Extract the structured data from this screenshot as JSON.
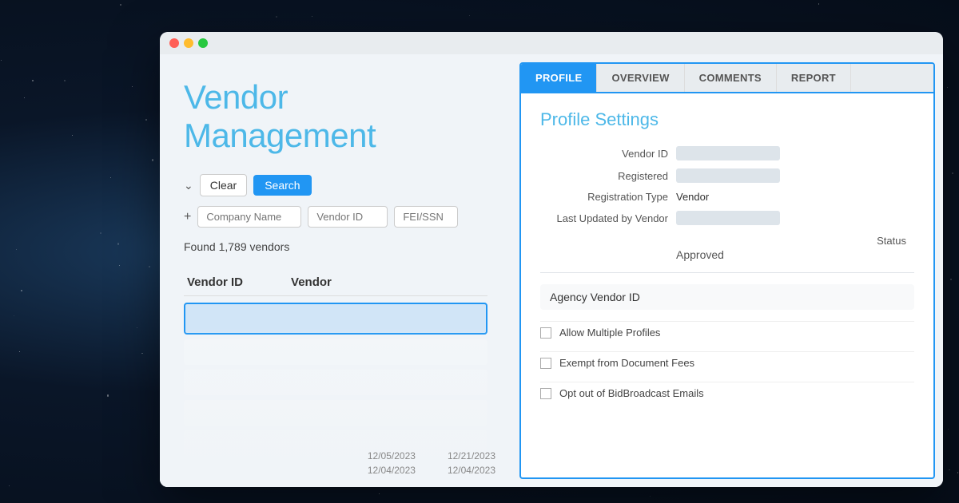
{
  "background": {
    "color": "#0a1628"
  },
  "browser": {
    "traffic_lights": [
      "red",
      "yellow",
      "green"
    ]
  },
  "left_panel": {
    "title": "Vendor Management",
    "search": {
      "clear_label": "Clear",
      "search_label": "Search"
    },
    "filters": {
      "company_name_placeholder": "Company Name",
      "vendor_id_placeholder": "Vendor ID",
      "fei_placeholder": "FEI/SSN"
    },
    "results_count": "Found 1,789 vendors",
    "table": {
      "col1": "Vendor ID",
      "col2": "Vendor"
    }
  },
  "right_panel": {
    "tabs": [
      {
        "label": "PROFILE",
        "active": true
      },
      {
        "label": "OVERVIEW",
        "active": false
      },
      {
        "label": "COMMENTS",
        "active": false
      },
      {
        "label": "REPORT",
        "active": false
      }
    ],
    "profile": {
      "title": "Profile Settings",
      "fields": [
        {
          "label": "Vendor ID",
          "type": "bar"
        },
        {
          "label": "Registered",
          "type": "bar"
        },
        {
          "label": "Registration Type",
          "type": "text",
          "value": "Vendor"
        },
        {
          "label": "Last Updated by Vendor",
          "type": "bar"
        }
      ],
      "status_label": "Status",
      "status_value": "Approved",
      "agency_vendor_id_label": "Agency Vendor ID",
      "checkboxes": [
        {
          "label": "Allow Multiple Profiles",
          "checked": false
        },
        {
          "label": "Exempt from Document Fees",
          "checked": false
        },
        {
          "label": "Opt out of BidBroadcast Emails",
          "checked": false
        }
      ]
    }
  },
  "date_rows": [
    {
      "col1": "12/05/2023",
      "col2": "12/21/2023"
    },
    {
      "col1": "12/04/2023",
      "col2": "12/04/2023"
    }
  ]
}
